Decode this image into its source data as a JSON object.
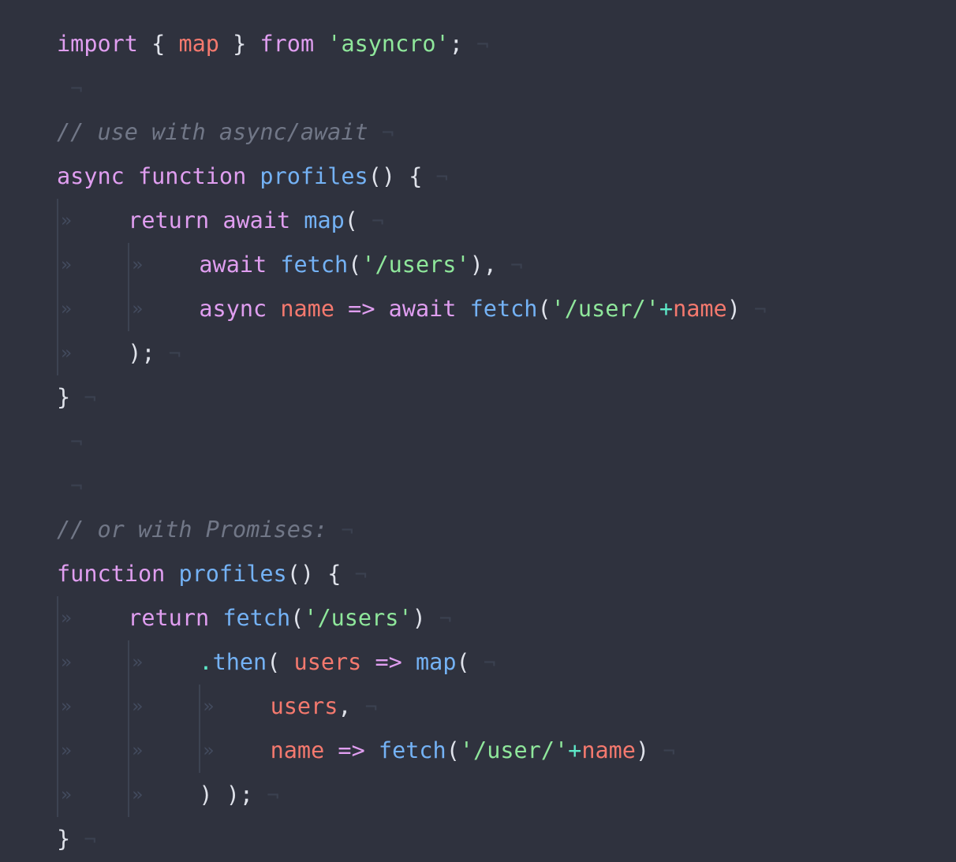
{
  "editor": {
    "language": "javascript",
    "theme": "dark",
    "background_color": "#2f323e",
    "indent_size": 4,
    "show_indent_guides": true,
    "show_whitespace_markers": true,
    "show_eol_markers": true,
    "tab_marker_glyph": "»",
    "eol_marker_glyph": "¬"
  },
  "palette": {
    "background": "#2f323e",
    "keyword": "#e09ef0",
    "function": "#74b2f5",
    "string": "#8fe79b",
    "parameter": "#f4796e",
    "operator": "#5ee9c8",
    "punctuation": "#dfe2ea",
    "comment": "#717787",
    "indent_guide": "#3d4352",
    "marker": "#3b4150"
  },
  "code": {
    "lines": [
      {
        "indent": 0,
        "tokens": [
          {
            "text": "import",
            "type": "kw"
          },
          {
            "text": " ",
            "type": "plain"
          },
          {
            "text": "{",
            "type": "punc"
          },
          {
            "text": " ",
            "type": "plain"
          },
          {
            "text": "map",
            "type": "param"
          },
          {
            "text": " ",
            "type": "plain"
          },
          {
            "text": "}",
            "type": "punc"
          },
          {
            "text": " ",
            "type": "plain"
          },
          {
            "text": "from",
            "type": "kw"
          },
          {
            "text": " ",
            "type": "plain"
          },
          {
            "text": "'asyncro'",
            "type": "str"
          },
          {
            "text": ";",
            "type": "punc"
          }
        ]
      },
      {
        "indent": 0,
        "tokens": []
      },
      {
        "indent": 0,
        "tokens": [
          {
            "text": "// use with async/await",
            "type": "comment"
          }
        ]
      },
      {
        "indent": 0,
        "tokens": [
          {
            "text": "async",
            "type": "kw"
          },
          {
            "text": " ",
            "type": "plain"
          },
          {
            "text": "function",
            "type": "kw"
          },
          {
            "text": " ",
            "type": "plain"
          },
          {
            "text": "profiles",
            "type": "fn"
          },
          {
            "text": "()",
            "type": "punc"
          },
          {
            "text": " ",
            "type": "plain"
          },
          {
            "text": "{",
            "type": "punc"
          }
        ]
      },
      {
        "indent": 1,
        "tokens": [
          {
            "text": "return",
            "type": "kw"
          },
          {
            "text": " ",
            "type": "plain"
          },
          {
            "text": "await",
            "type": "kw"
          },
          {
            "text": " ",
            "type": "plain"
          },
          {
            "text": "map",
            "type": "fn"
          },
          {
            "text": "(",
            "type": "punc"
          }
        ]
      },
      {
        "indent": 2,
        "tokens": [
          {
            "text": "await",
            "type": "kw"
          },
          {
            "text": " ",
            "type": "plain"
          },
          {
            "text": "fetch",
            "type": "fn"
          },
          {
            "text": "(",
            "type": "punc"
          },
          {
            "text": "'/users'",
            "type": "str"
          },
          {
            "text": ")",
            "type": "punc"
          },
          {
            "text": ",",
            "type": "punc"
          }
        ]
      },
      {
        "indent": 2,
        "tokens": [
          {
            "text": "async",
            "type": "kw"
          },
          {
            "text": " ",
            "type": "plain"
          },
          {
            "text": "name",
            "type": "param"
          },
          {
            "text": " ",
            "type": "plain"
          },
          {
            "text": "=>",
            "type": "kw"
          },
          {
            "text": " ",
            "type": "plain"
          },
          {
            "text": "await",
            "type": "kw"
          },
          {
            "text": " ",
            "type": "plain"
          },
          {
            "text": "fetch",
            "type": "fn"
          },
          {
            "text": "(",
            "type": "punc"
          },
          {
            "text": "'/user/'",
            "type": "str"
          },
          {
            "text": "+",
            "type": "op"
          },
          {
            "text": "name",
            "type": "param"
          },
          {
            "text": ")",
            "type": "punc"
          }
        ]
      },
      {
        "indent": 1,
        "tokens": [
          {
            "text": ")",
            "type": "punc"
          },
          {
            "text": ";",
            "type": "punc"
          }
        ]
      },
      {
        "indent": 0,
        "tokens": [
          {
            "text": "}",
            "type": "punc"
          }
        ]
      },
      {
        "indent": 0,
        "tokens": []
      },
      {
        "indent": 0,
        "tokens": []
      },
      {
        "indent": 0,
        "tokens": [
          {
            "text": "// or with Promises:",
            "type": "comment"
          }
        ]
      },
      {
        "indent": 0,
        "tokens": [
          {
            "text": "function",
            "type": "kw"
          },
          {
            "text": " ",
            "type": "plain"
          },
          {
            "text": "profiles",
            "type": "fn"
          },
          {
            "text": "()",
            "type": "punc"
          },
          {
            "text": " ",
            "type": "plain"
          },
          {
            "text": "{",
            "type": "punc"
          }
        ]
      },
      {
        "indent": 1,
        "tokens": [
          {
            "text": "return",
            "type": "kw"
          },
          {
            "text": " ",
            "type": "plain"
          },
          {
            "text": "fetch",
            "type": "fn"
          },
          {
            "text": "(",
            "type": "punc"
          },
          {
            "text": "'/users'",
            "type": "str"
          },
          {
            "text": ")",
            "type": "punc"
          }
        ]
      },
      {
        "indent": 2,
        "tokens": [
          {
            "text": ".",
            "type": "op"
          },
          {
            "text": "then",
            "type": "fn"
          },
          {
            "text": "(",
            "type": "punc"
          },
          {
            "text": " ",
            "type": "plain"
          },
          {
            "text": "users",
            "type": "param"
          },
          {
            "text": " ",
            "type": "plain"
          },
          {
            "text": "=>",
            "type": "kw"
          },
          {
            "text": " ",
            "type": "plain"
          },
          {
            "text": "map",
            "type": "fn"
          },
          {
            "text": "(",
            "type": "punc"
          }
        ]
      },
      {
        "indent": 3,
        "tokens": [
          {
            "text": "users",
            "type": "param"
          },
          {
            "text": ",",
            "type": "punc"
          }
        ]
      },
      {
        "indent": 3,
        "tokens": [
          {
            "text": "name",
            "type": "param"
          },
          {
            "text": " ",
            "type": "plain"
          },
          {
            "text": "=>",
            "type": "kw"
          },
          {
            "text": " ",
            "type": "plain"
          },
          {
            "text": "fetch",
            "type": "fn"
          },
          {
            "text": "(",
            "type": "punc"
          },
          {
            "text": "'/user/'",
            "type": "str"
          },
          {
            "text": "+",
            "type": "op"
          },
          {
            "text": "name",
            "type": "param"
          },
          {
            "text": ")",
            "type": "punc"
          }
        ]
      },
      {
        "indent": 2,
        "tokens": [
          {
            "text": ")",
            "type": "punc"
          },
          {
            "text": " ",
            "type": "plain"
          },
          {
            "text": ")",
            "type": "punc"
          },
          {
            "text": ";",
            "type": "punc"
          }
        ]
      },
      {
        "indent": 0,
        "tokens": [
          {
            "text": "}",
            "type": "punc"
          }
        ]
      }
    ]
  }
}
